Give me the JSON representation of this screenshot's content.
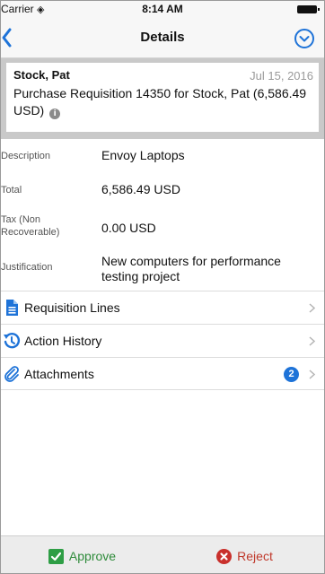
{
  "status_bar": {
    "carrier": "Carrier",
    "time": "8:14 AM"
  },
  "nav": {
    "title": "Details",
    "back_icon": "chevron-left-icon",
    "menu_icon": "circle-chevron-down-icon",
    "accent": "#1e73d8"
  },
  "header": {
    "requester": "Stock, Pat",
    "date": "Jul 15, 2016",
    "subject": "Purchase Requisition 14350 for Stock, Pat (6,586.49 USD)",
    "info_icon": "info-icon",
    "info_glyph": "i"
  },
  "fields": [
    {
      "label": "Description",
      "value": "Envoy Laptops"
    },
    {
      "label": "Total",
      "value": "6,586.49 USD"
    },
    {
      "label": "Tax (Non Recoverable)",
      "value": "0.00 USD"
    },
    {
      "label": "Justification",
      "value": "New computers for performance testing project"
    }
  ],
  "list": [
    {
      "label": "Requisition Lines",
      "icon": "document-icon"
    },
    {
      "label": "Action History",
      "icon": "history-icon"
    },
    {
      "label": "Attachments",
      "icon": "paperclip-icon",
      "badge": "2"
    }
  ],
  "actions": {
    "approve": {
      "label": "Approve",
      "color": "#2e8b3a",
      "icon": "checkbox-check-icon"
    },
    "reject": {
      "label": "Reject",
      "color": "#c0392b",
      "icon": "circle-x-icon"
    }
  }
}
